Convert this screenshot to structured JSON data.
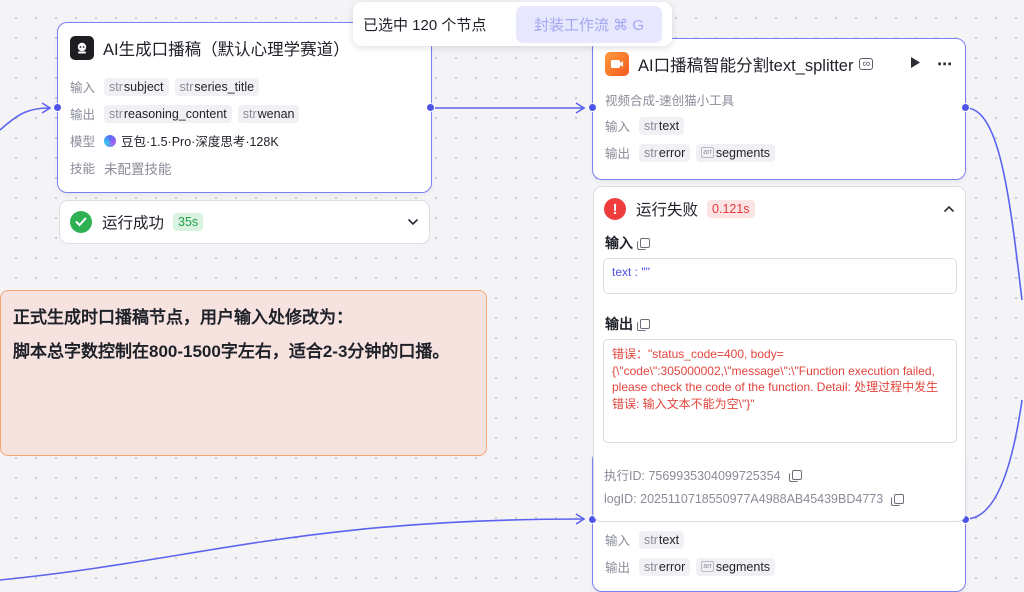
{
  "toolbar": {
    "selection_text": "已选中 120 个节点",
    "wrap_button": "封装工作流 ⌘ G"
  },
  "node_left": {
    "title": "AI生成口播稿（默认心理学赛道）",
    "input_label": "输入",
    "inputs": [
      {
        "type": "str",
        "name": "subject"
      },
      {
        "type": "str",
        "name": "series_title"
      }
    ],
    "output_label": "输出",
    "outputs": [
      {
        "type": "str",
        "name": "reasoning_content"
      },
      {
        "type": "str",
        "name": "wenan"
      }
    ],
    "model_label": "模型",
    "model_value": "豆包·1.5·Pro·深度思考·128K",
    "skill_label": "技能",
    "skill_value": "未配置技能"
  },
  "status_left": {
    "text": "运行成功",
    "duration": "35s"
  },
  "node_right": {
    "title": "AI口播稿智能分割text_splitter",
    "subtitle": "视频合成-速创猫小工具",
    "input_label": "输入",
    "inputs": [
      {
        "type": "str",
        "name": "text"
      }
    ],
    "output_label": "输出",
    "outputs": [
      {
        "type": "str",
        "name": "error"
      },
      {
        "type": "arr",
        "name": "segments"
      }
    ]
  },
  "run_panel": {
    "status_text": "运行失败",
    "duration": "0.121s",
    "input_label": "输入",
    "input_value": "text : \"\"",
    "output_label": "输出",
    "output_value": "错误：\"status_code=400, body={\\\"code\\\":305000002,\\\"message\\\":\\\"Function execution failed, please check the code of the function. Detail: 处理过程中发生错误: 输入文本不能为空\\\"}\"",
    "exec_id": "执行ID: 7569935304099725354",
    "log_id": "logID: 2025110718550977A4988AB45439BD4773"
  },
  "node_bottom": {
    "input_label": "输入",
    "inputs": [
      {
        "type": "str",
        "name": "text"
      }
    ],
    "output_label": "输出",
    "outputs": [
      {
        "type": "str",
        "name": "error"
      },
      {
        "type": "arr",
        "name": "segments"
      }
    ]
  },
  "note": {
    "line1": "正式生成时口播稿节点，用户输入处修改为：",
    "line2": "脚本总字数控制在800-1500字左右，适合2-3分钟的口播。"
  },
  "colors": {
    "accent": "#4e54e8",
    "node_border": "#7d7ff0",
    "success": "#2fb153",
    "error": "#ef3c3c"
  }
}
